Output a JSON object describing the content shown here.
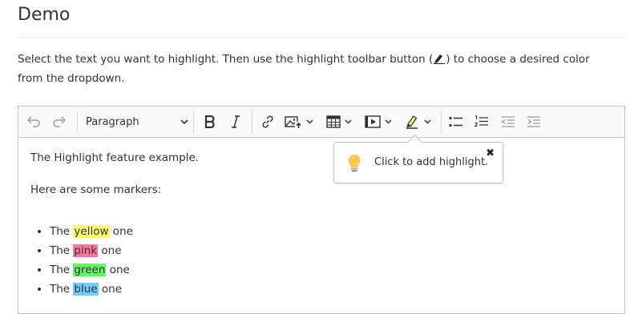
{
  "page": {
    "title": "Demo",
    "description_before": "Select the text you want to highlight. Then use the highlight toolbar button (",
    "description_after": ") to choose a desired color from the dropdown."
  },
  "toolbar": {
    "undo_icon": "undo-icon",
    "redo_icon": "redo-icon",
    "heading_select": "Paragraph",
    "bold_icon": "bold-icon",
    "italic_icon": "italic-icon",
    "link_icon": "link-icon",
    "image_icon": "image-upload-icon",
    "table_icon": "table-icon",
    "media_icon": "media-embed-icon",
    "highlight_icon": "highlight-marker-icon",
    "bulleted_list_icon": "bulleted-list-icon",
    "numbered_list_icon": "numbered-list-icon",
    "outdent_icon": "outdent-icon",
    "indent_icon": "indent-icon"
  },
  "content": {
    "paragraph1": "The Highlight feature example.",
    "paragraph2": "Here are some markers:",
    "items": [
      {
        "prefix": "The ",
        "highlight": "yellow",
        "suffix": " one",
        "color": "#fdfd77"
      },
      {
        "prefix": "The ",
        "highlight": "pink",
        "suffix": " one",
        "color": "#fc7899"
      },
      {
        "prefix": "The ",
        "highlight": "green",
        "suffix": " one",
        "color": "#62f962"
      },
      {
        "prefix": "The ",
        "highlight": "blue",
        "suffix": " one",
        "color": "#72ccfd"
      }
    ]
  },
  "popup": {
    "text": "Click to add highlight.",
    "close": "✖",
    "icon": "lightbulb-icon"
  },
  "colors": {
    "border": "#c4c4c4",
    "toolbar_bg": "#fafafa",
    "icon": "#333333"
  }
}
